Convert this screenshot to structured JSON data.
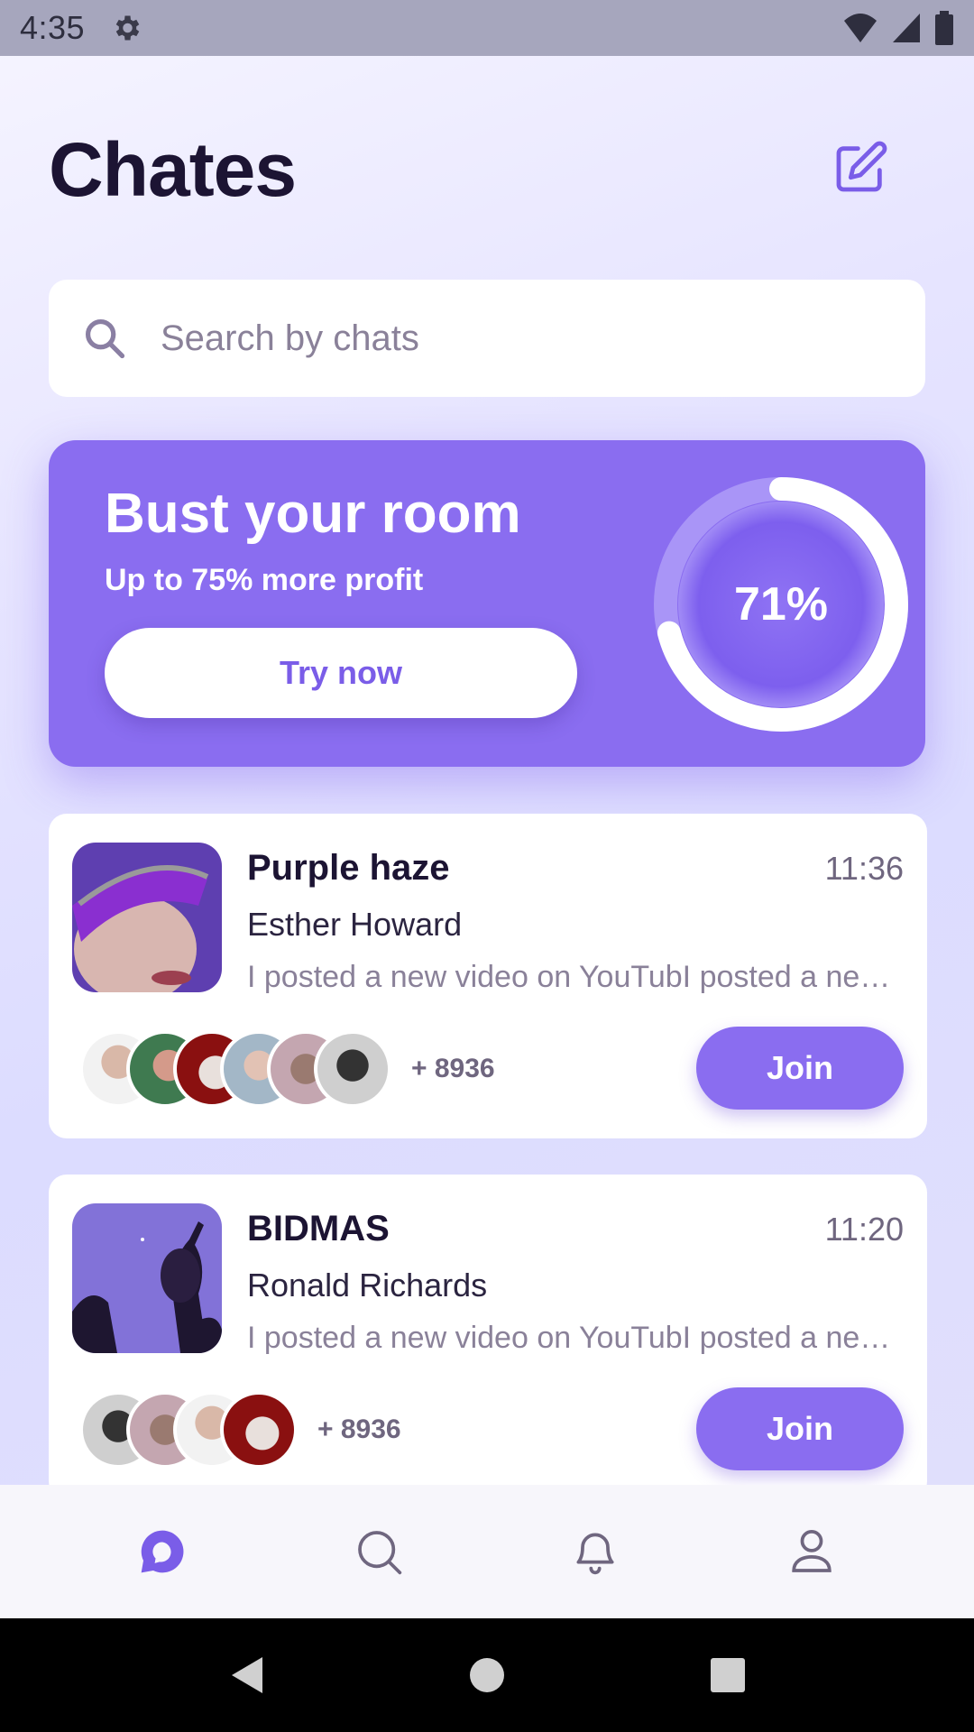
{
  "status_bar": {
    "time": "4:35",
    "icons": [
      "gear-icon",
      "wifi-icon",
      "signal-icon",
      "battery-icon"
    ]
  },
  "header": {
    "title": "Chates",
    "edit_icon": "edit-icon"
  },
  "search": {
    "placeholder": "Search by chats",
    "value": ""
  },
  "promo": {
    "title": "Bust your room",
    "subtitle": "Up to 75% more profit",
    "button_label": "Try now",
    "progress_label": "71%",
    "progress_fraction": 0.71
  },
  "chats": [
    {
      "name": "Purple haze",
      "time": "11:36",
      "author": "Esther Howard",
      "preview": "I posted a new video on YouTubI posted a new video on YouTube",
      "member_count": "+ 8936",
      "join_label": "Join",
      "avatar_count": 6
    },
    {
      "name": "BIDMAS",
      "time": "11:20",
      "author": "Ronald Richards",
      "preview": "I posted a new video on YouTubI posted a new video on YouTube",
      "member_count": "+ 8936",
      "join_label": "Join",
      "avatar_count": 4
    }
  ],
  "bottom_nav": {
    "items": [
      "chat-icon",
      "search-icon",
      "bell-icon",
      "profile-icon"
    ],
    "active": "chat-icon"
  },
  "colors": {
    "accent": "#8a6df0",
    "title": "#1c1433",
    "muted": "#8a8199"
  }
}
